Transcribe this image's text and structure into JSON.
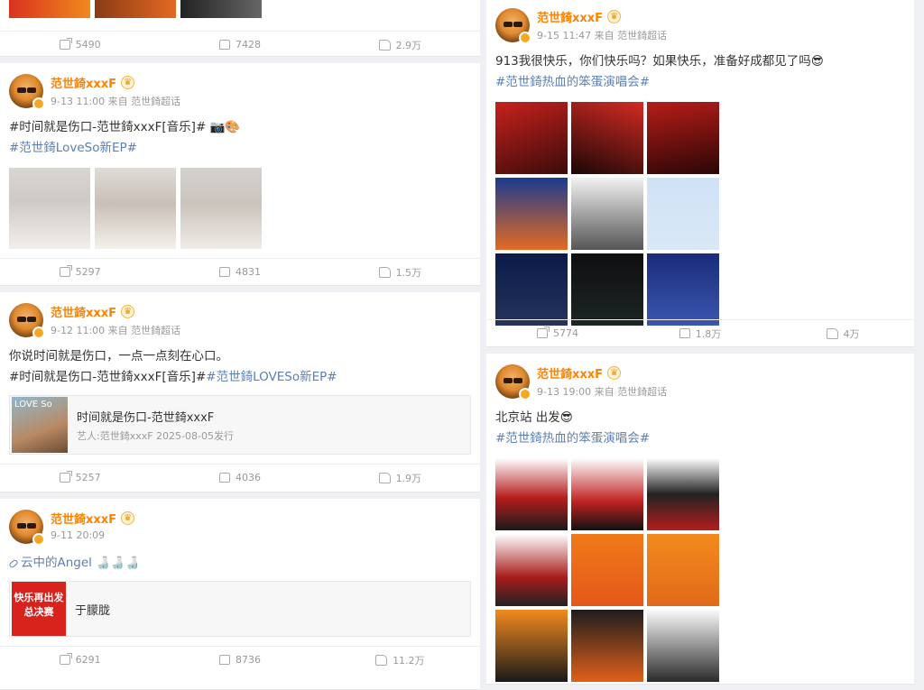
{
  "user": {
    "name": "范世錡xxxF",
    "source_label": "来自",
    "source": "范世錡超话"
  },
  "colors": {
    "accent": "#ff8200",
    "link": "#5b7fb5"
  },
  "left_column": {
    "top_partial": {
      "reposts": "5490",
      "comments": "7428",
      "likes": "2.9万"
    },
    "post1": {
      "time": "9-13 11:00",
      "line1": "#时间就是伤口-范世錡xxxF[音乐]# 📷🎨",
      "hashtag": "#范世錡LoveSo新EP#",
      "reposts": "5297",
      "comments": "4831",
      "likes": "1.5万"
    },
    "post2": {
      "time": "9-12 11:00",
      "line1": "你说时间就是伤口，一点一点刻在心口。",
      "line2_plain": "#时间就是伤口-范世錡xxxF[音乐]#",
      "line2_tag": "#范世錡LOVESo新EP#",
      "music_title": "时间就是伤口-范世錡xxxF",
      "music_sub": "艺人:范世錡xxxF 2025-08-05发行",
      "music_thumb_text": "LOVE So",
      "reposts": "5257",
      "comments": "4036",
      "likes": "1.9万"
    },
    "post3": {
      "time": "9-11 20:09",
      "link_text": "云中的Angel",
      "emoji": "🍶🍶🍶",
      "card_title": "于朦胧",
      "card_thumb_text": "快乐再出发 总决赛",
      "reposts": "6291",
      "comments": "8736",
      "likes": "11.2万"
    }
  },
  "right_column": {
    "post1": {
      "time": "9-15 11:47",
      "line1": "913我很快乐，你们快乐吗？如果快乐，准备好成都见了吗😎",
      "hashtag": "#范世錡热血的笨蛋演唱会#",
      "reposts": "5774",
      "comments": "1.8万",
      "likes": "4万"
    },
    "post2": {
      "time": "9-13 19:00",
      "line1": "北京站 出发😎",
      "hashtag": "#范世錡热血的笨蛋演唱会#"
    }
  }
}
